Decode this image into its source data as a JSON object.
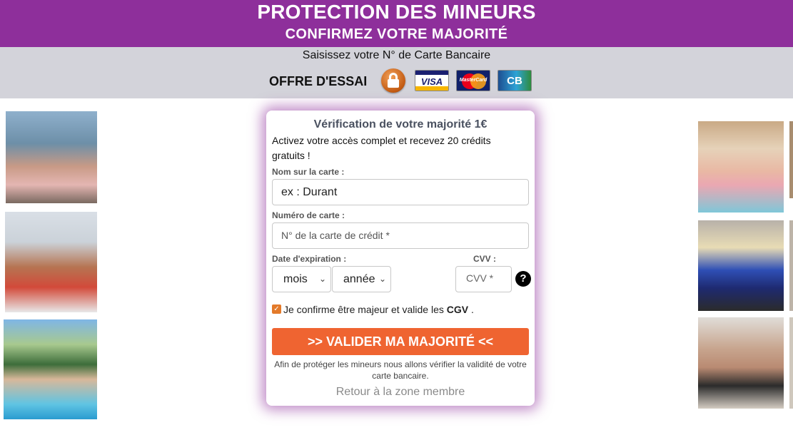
{
  "header": {
    "title": "PROTECTION DES MINEURS",
    "subtitle": "CONFIRMEZ VOTRE MAJORITÉ"
  },
  "info_bar": {
    "instruction": "Saisissez votre N° de Carte Bancaire",
    "offer_label": "OFFRE D'ESSAI",
    "icons": [
      "lock-icon",
      "visa-logo",
      "mastercard-logo",
      "cb-logo"
    ],
    "visa_text": "VISA",
    "mastercard_text": "MasterCard",
    "cb_text": "CB"
  },
  "form": {
    "title": "Vérification de votre majorité 1€",
    "intro": "Activez votre accès complet et recevez 20 crédits gratuits !",
    "name_label": "Nom sur la carte :",
    "name_placeholder": "ex : Durant",
    "card_label": "Numéro de carte :",
    "card_placeholder": "N° de la carte de crédit *",
    "expiry_label": "Date d'expiration :",
    "month_value": "mois",
    "year_value": "année",
    "cvv_label": "CVV :",
    "cvv_placeholder": "CVV *",
    "help_symbol": "?",
    "confirm_text": "Je confirme être majeur et valide les",
    "confirm_link": "CGV",
    "confirm_end": ".",
    "confirm_checked": true,
    "submit_label": ">> VALIDER MA MAJORITÉ <<",
    "note": "Afin de protéger les mineurs nous allons vérifier la validité de votre carte bancaire.",
    "back_link": "Retour à la zone membre"
  },
  "colors": {
    "header_bg": "#8e2f9b",
    "bar_bg": "#d3d3da",
    "button_bg": "#ef6431",
    "panel_glow": "#8e2f9b"
  }
}
